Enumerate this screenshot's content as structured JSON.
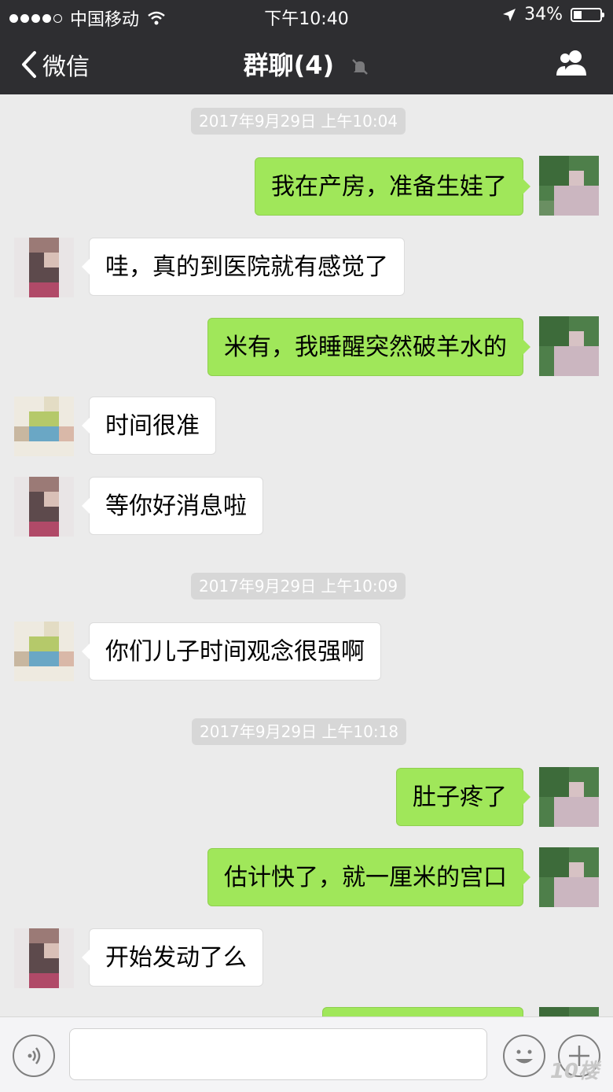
{
  "status_bar": {
    "carrier": "中国移动",
    "time": "下午10:40",
    "battery": "34%"
  },
  "nav": {
    "back_label": "微信",
    "title": "群聊(4)"
  },
  "messages": [
    {
      "type": "time",
      "text": "2017年9月29日 上午10:04"
    },
    {
      "type": "out",
      "text": "我在产房，准备生娃了"
    },
    {
      "type": "in",
      "text": "哇，真的到医院就有感觉了"
    },
    {
      "type": "out",
      "text": "米有，我睡醒突然破羊水的"
    },
    {
      "type": "in",
      "text": "时间很准"
    },
    {
      "type": "in",
      "text": "等你好消息啦"
    },
    {
      "type": "time",
      "text": "2017年9月29日 上午10:09"
    },
    {
      "type": "in",
      "text": "你们儿子时间观念很强啊"
    },
    {
      "type": "time",
      "text": "2017年9月29日 上午10:18"
    },
    {
      "type": "out",
      "text": "肚子疼了"
    },
    {
      "type": "out",
      "text": "估计快了，就一厘米的宫口"
    },
    {
      "type": "in",
      "text": "开始发动了么"
    }
  ],
  "watermark": "10楼"
}
